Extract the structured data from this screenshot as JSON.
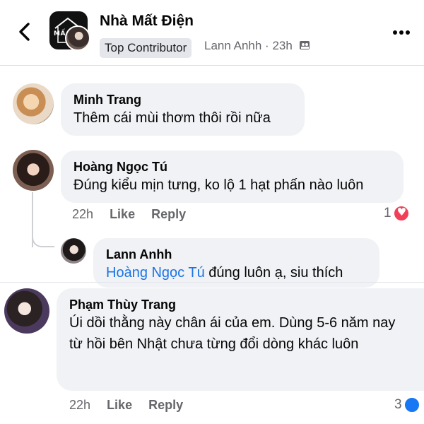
{
  "header": {
    "page_title": "Nhà Mất Điện",
    "logo_text": "MẤ",
    "badge": "Top Contributor",
    "author": "Lann Anhh",
    "time": "23h",
    "separator": "·"
  },
  "comments": [
    {
      "name": "Minh Trang",
      "text": "Thêm cái mùi thơm thôi rồi nữa"
    },
    {
      "name": "Hoàng Ngọc Tú",
      "text": "Đúng kiểu mịn tưng, ko lộ 1 hạt phấn nào luôn",
      "time": "22h",
      "like": "Like",
      "reply": "Reply",
      "reaction_count": "1"
    }
  ],
  "reply": {
    "name": "Lann Anhh",
    "mention": "Hoàng Ngọc Tú",
    "text": " đúng luôn ạ, siu thích"
  },
  "comment3": {
    "name": "Phạm Thùy Trang",
    "text": "Úi dồi thằng này chân ái của em. Dùng 5-6 năm nay từ hồi bên Nhật chưa từng đổi dòng khác luôn",
    "time": "22h",
    "like": "Like",
    "reply": "Reply",
    "reaction_count": "3"
  },
  "icons": {
    "back": "chevron-left-icon",
    "more": "more-dots-icon",
    "group": "group-icon",
    "heart": "heart-reaction-icon"
  },
  "colors": {
    "bubble": "#f0f2f5",
    "mention": "#1b74e4",
    "heart": "#f33e58",
    "meta": "#65676b"
  }
}
